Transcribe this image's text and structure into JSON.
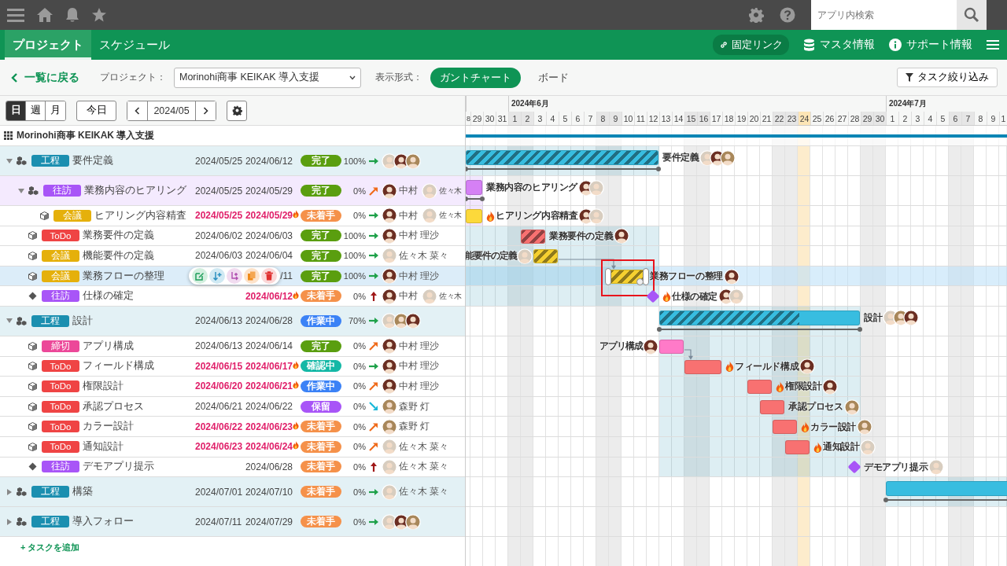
{
  "topbar": {
    "search": {
      "placeholder": "アプリ内検索"
    }
  },
  "nav": {
    "tabs": [
      {
        "label": "プロジェクト",
        "selected": true
      },
      {
        "label": "スケジュール",
        "selected": false
      }
    ],
    "links": [
      {
        "kind": "link",
        "label": "固定リンク"
      },
      {
        "kind": "database",
        "label": "マスタ情報"
      },
      {
        "kind": "info",
        "label": "サポート情報"
      }
    ]
  },
  "toolbar": {
    "back": "一覧に戻る",
    "project_label": "プロジェクト：",
    "project": "Morinohi商事 KEIKAK 導入支援",
    "view_label": "表示形式：",
    "views": [
      {
        "label": "ガントチャート",
        "selected": true
      },
      {
        "label": "ボード",
        "selected": false
      }
    ],
    "filter": "タスク絞り込み"
  },
  "controls": {
    "scales": [
      {
        "label": "日",
        "selected": true
      },
      {
        "label": "週",
        "selected": false
      },
      {
        "label": "月",
        "selected": false
      }
    ],
    "today": "今日",
    "period": "2024/05"
  },
  "project_title": "Morinohi商事 KEIKAK 導入支援",
  "timeline": {
    "lead_days": [
      {
        "label": "8",
        "weekend": false,
        "today": false
      },
      {
        "label": "29",
        "weekend": false,
        "today": false
      },
      {
        "label": "30",
        "weekend": false,
        "today": false
      },
      {
        "label": "31",
        "weekend": false,
        "today": false
      }
    ],
    "months": [
      {
        "label": "2024年6月",
        "days": [
          {
            "label": "1",
            "weekend": true,
            "today": false
          },
          {
            "label": "2",
            "weekend": true,
            "today": false
          },
          {
            "label": "3",
            "weekend": false,
            "today": false
          },
          {
            "label": "4",
            "weekend": false,
            "today": false
          },
          {
            "label": "5",
            "weekend": false,
            "today": false
          },
          {
            "label": "6",
            "weekend": false,
            "today": false
          },
          {
            "label": "7",
            "weekend": false,
            "today": false
          },
          {
            "label": "8",
            "weekend": true,
            "today": false
          },
          {
            "label": "9",
            "weekend": true,
            "today": false
          },
          {
            "label": "10",
            "weekend": false,
            "today": false
          },
          {
            "label": "11",
            "weekend": false,
            "today": false
          },
          {
            "label": "12",
            "weekend": false,
            "today": false
          },
          {
            "label": "13",
            "weekend": false,
            "today": false
          },
          {
            "label": "14",
            "weekend": false,
            "today": false
          },
          {
            "label": "15",
            "weekend": true,
            "today": false
          },
          {
            "label": "16",
            "weekend": true,
            "today": false
          },
          {
            "label": "17",
            "weekend": false,
            "today": false
          },
          {
            "label": "18",
            "weekend": false,
            "today": false
          },
          {
            "label": "19",
            "weekend": false,
            "today": false
          },
          {
            "label": "20",
            "weekend": false,
            "today": false
          },
          {
            "label": "21",
            "weekend": false,
            "today": false
          },
          {
            "label": "22",
            "weekend": true,
            "today": false
          },
          {
            "label": "23",
            "weekend": true,
            "today": false
          },
          {
            "label": "24",
            "weekend": false,
            "today": true
          },
          {
            "label": "25",
            "weekend": false,
            "today": false
          },
          {
            "label": "26",
            "weekend": false,
            "today": false
          },
          {
            "label": "27",
            "weekend": false,
            "today": false
          },
          {
            "label": "28",
            "weekend": false,
            "today": false
          },
          {
            "label": "29",
            "weekend": true,
            "today": false
          },
          {
            "label": "30",
            "weekend": true,
            "today": false
          }
        ]
      },
      {
        "label": "2024年7月",
        "days": [
          {
            "label": "1",
            "weekend": false,
            "today": false
          },
          {
            "label": "2",
            "weekend": false,
            "today": false
          },
          {
            "label": "3",
            "weekend": false,
            "today": false
          },
          {
            "label": "4",
            "weekend": false,
            "today": false
          },
          {
            "label": "5",
            "weekend": false,
            "today": false
          },
          {
            "label": "6",
            "weekend": true,
            "today": false
          },
          {
            "label": "7",
            "weekend": true,
            "today": false
          },
          {
            "label": "8",
            "weekend": false,
            "today": false
          },
          {
            "label": "9",
            "weekend": false,
            "today": false
          },
          {
            "label": "1",
            "weekend": false,
            "today": false
          }
        ]
      }
    ]
  },
  "tasks": [
    {
      "kind": "group",
      "expanded": true,
      "selected": false,
      "tag": {
        "label": "工程",
        "color": "#1b8fb0"
      },
      "name": "要件定義",
      "start": "2024/05/25",
      "end": "2024/06/12",
      "overdue": false,
      "status": {
        "label": "完了",
        "color": "#5a9e0f"
      },
      "progress": "100%",
      "level": 1,
      "priority": {
        "kind": "normal"
      },
      "assignees": [
        {
          "color": "#d8cdbf"
        },
        {
          "color": "#6b2e22"
        },
        {
          "color": "#a8875a"
        }
      ],
      "bar": {
        "kind": "summary",
        "color": "#38bde0",
        "label": {
          "kind": "after",
          "text": "要件定義"
        },
        "link": false
      },
      "children": [
        {
          "kind": "group",
          "expanded": true,
          "selected": false,
          "tag": {
            "label": "往訪",
            "color": "#a855f7"
          },
          "name": "業務内容のヒアリング",
          "start": "2024/05/25",
          "end": "2024/05/29",
          "overdue": false,
          "status": {
            "label": "完了",
            "color": "#5a9e0f"
          },
          "progress": "0%",
          "priority": {
            "kind": "high"
          },
          "assignees": [
            {
              "name": "中村",
              "color": "#6b2e22"
            },
            {
              "name": "佐々木",
              "color": "#d8cdbf"
            }
          ],
          "bar": {
            "kind": "summary",
            "color": "#d580f5",
            "label": {
              "kind": "after",
              "text": "業務内容のヒアリング"
            },
            "link": false
          },
          "children": [
            {
              "kind": "task",
              "selected": false,
              "tag": {
                "label": "会議",
                "color": "#e5b00b"
              },
              "name": "ヒアリング内容精査",
              "start": "2024/05/25",
              "end": "2024/05/29",
              "overdue": true,
              "status": {
                "label": "未着手",
                "color": "#f5914a"
              },
              "progress": "0%",
              "priority": {
                "kind": "normal"
              },
              "assignees": [
                {
                  "name": "中村",
                  "color": "#6b2e22"
                },
                {
                  "name": "佐々木",
                  "color": "#d8cdbf"
                }
              ],
              "bar": {
                "kind": "task",
                "color": "#fcd93b",
                "label": {
                  "kind": "after",
                  "text": "ヒアリング内容精査"
                },
                "link": false
              }
            }
          ]
        },
        {
          "kind": "task",
          "selected": false,
          "tag": {
            "label": "ToDo",
            "color": "#ef4444"
          },
          "name": "業務要件の定義",
          "start": "2024/06/02",
          "end": "2024/06/03",
          "overdue": false,
          "status": {
            "label": "完了",
            "color": "#5a9e0f"
          },
          "progress": "100%",
          "level": 1,
          "priority": {
            "kind": "normal"
          },
          "assignees": [
            {
              "name": "中村 理沙",
              "color": "#6b2e22"
            }
          ],
          "bar": {
            "kind": "task",
            "color": "#f87171",
            "label": {
              "kind": "after",
              "text": "業務要件の定義"
            },
            "link": false
          }
        },
        {
          "kind": "task",
          "selected": false,
          "tag": {
            "label": "会議",
            "color": "#e5b00b"
          },
          "name": "機能要件の定義",
          "start": "2024/06/03",
          "end": "2024/06/04",
          "overdue": false,
          "status": {
            "label": "完了",
            "color": "#5a9e0f"
          },
          "progress": "100%",
          "level": 1,
          "priority": {
            "kind": "normal"
          },
          "assignees": [
            {
              "name": "佐々木 菜々",
              "color": "#d8cdbf"
            }
          ],
          "bar": {
            "kind": "task",
            "color": "#f5d030",
            "label": {
              "kind": "before",
              "text": "能要件の定義"
            },
            "link": true
          }
        },
        {
          "kind": "task",
          "selected": true,
          "tag": {
            "label": "会議",
            "color": "#e5b00b"
          },
          "name": "業務フローの整理",
          "end": "/11",
          "overdue": false,
          "status": {
            "label": "完了",
            "color": "#5a9e0f"
          },
          "progress": "100%",
          "level": 1,
          "priority": {
            "kind": "normal"
          },
          "assignees": [
            {
              "name": "中村 理沙",
              "color": "#6b2e22"
            }
          ],
          "bar": {
            "kind": "task",
            "color": "#f5d030",
            "label": {
              "kind": "after",
              "text": "業務フローの整理"
            },
            "link": false
          }
        },
        {
          "kind": "milestone",
          "selected": false,
          "tag": {
            "label": "往訪",
            "color": "#a855f7"
          },
          "name": "仕様の確定",
          "end": "2024/06/12",
          "overdue": true,
          "status": {
            "label": "未着手",
            "color": "#f5914a"
          },
          "progress": "0%",
          "priority": {
            "kind": "urgent"
          },
          "assignees": [
            {
              "name": "中村",
              "color": "#6b2e22"
            },
            {
              "name": "佐々木",
              "color": "#d8cdbf"
            }
          ],
          "bar": {
            "kind": "milestone",
            "color": "#a855f7",
            "label": {
              "kind": "after",
              "text": "仕様の確定"
            },
            "link": false
          }
        }
      ]
    },
    {
      "kind": "group",
      "expanded": true,
      "selected": false,
      "tag": {
        "label": "工程",
        "color": "#1b8fb0"
      },
      "name": "設計",
      "start": "2024/06/13",
      "end": "2024/06/28",
      "overdue": false,
      "status": {
        "label": "作業中",
        "color": "#3b82f6"
      },
      "progress": "70%",
      "level": 0.7,
      "priority": {
        "kind": "normal"
      },
      "assignees": [
        {
          "color": "#d8cdbf"
        },
        {
          "color": "#a8875a"
        },
        {
          "color": "#6b2e22"
        }
      ],
      "bar": {
        "kind": "summary",
        "color": "#38bde0",
        "label": {
          "kind": "after",
          "text": "設計"
        },
        "link": false
      },
      "children": [
        {
          "kind": "task",
          "selected": false,
          "tag": {
            "label": "締切",
            "color": "#ec4899"
          },
          "name": "アプリ構成",
          "start": "2024/06/13",
          "end": "2024/06/14",
          "overdue": false,
          "status": {
            "label": "完了",
            "color": "#5a9e0f"
          },
          "progress": "0%",
          "priority": {
            "kind": "high"
          },
          "assignees": [
            {
              "name": "中村 理沙",
              "color": "#6b2e22"
            }
          ],
          "bar": {
            "kind": "task",
            "color": "#ff7ac8",
            "label": {
              "kind": "before",
              "text": "アプリ構成"
            },
            "link": true
          }
        },
        {
          "kind": "task",
          "selected": false,
          "tag": {
            "label": "ToDo",
            "color": "#ef4444"
          },
          "name": "フィールド構成",
          "start": "2024/06/15",
          "end": "2024/06/17",
          "overdue": true,
          "status": {
            "label": "確認中",
            "color": "#14b8a6"
          },
          "progress": "0%",
          "priority": {
            "kind": "normal"
          },
          "assignees": [
            {
              "name": "中村 理沙",
              "color": "#6b2e22"
            }
          ],
          "bar": {
            "kind": "task",
            "color": "#f87171",
            "label": {
              "kind": "after",
              "text": "フィールド構成"
            },
            "link": false
          }
        },
        {
          "kind": "task",
          "selected": false,
          "tag": {
            "label": "ToDo",
            "color": "#ef4444"
          },
          "name": "権限設計",
          "start": "2024/06/20",
          "end": "2024/06/21",
          "overdue": true,
          "status": {
            "label": "作業中",
            "color": "#3b82f6"
          },
          "progress": "0%",
          "priority": {
            "kind": "high"
          },
          "assignees": [
            {
              "name": "中村 理沙",
              "color": "#6b2e22"
            }
          ],
          "bar": {
            "kind": "task",
            "color": "#f87171",
            "label": {
              "kind": "after",
              "text": "権限設計"
            },
            "link": false
          }
        },
        {
          "kind": "task",
          "selected": false,
          "tag": {
            "label": "ToDo",
            "color": "#ef4444"
          },
          "name": "承認プロセス",
          "start": "2024/06/21",
          "end": "2024/06/22",
          "overdue": false,
          "status": {
            "label": "保留",
            "color": "#a855f7"
          },
          "progress": "0%",
          "priority": {
            "kind": "low"
          },
          "assignees": [
            {
              "name": "森野 灯",
              "color": "#a8875a"
            }
          ],
          "bar": {
            "kind": "task",
            "color": "#f87171",
            "label": {
              "kind": "after",
              "text": "承認プロセス"
            },
            "link": false
          }
        },
        {
          "kind": "task",
          "selected": false,
          "tag": {
            "label": "ToDo",
            "color": "#ef4444"
          },
          "name": "カラー設計",
          "start": "2024/06/22",
          "end": "2024/06/23",
          "overdue": true,
          "status": {
            "label": "未着手",
            "color": "#f5914a"
          },
          "progress": "0%",
          "priority": {
            "kind": "high"
          },
          "assignees": [
            {
              "name": "森野 灯",
              "color": "#a8875a"
            }
          ],
          "bar": {
            "kind": "task",
            "color": "#f87171",
            "label": {
              "kind": "after",
              "text": "カラー設計"
            },
            "link": false
          }
        },
        {
          "kind": "task",
          "selected": false,
          "tag": {
            "label": "ToDo",
            "color": "#ef4444"
          },
          "name": "通知設計",
          "start": "2024/06/23",
          "end": "2024/06/24",
          "overdue": true,
          "status": {
            "label": "未着手",
            "color": "#f5914a"
          },
          "progress": "0%",
          "priority": {
            "kind": "high"
          },
          "assignees": [
            {
              "name": "佐々木 菜々",
              "color": "#d8cdbf"
            }
          ],
          "bar": {
            "kind": "task",
            "color": "#f87171",
            "label": {
              "kind": "after",
              "text": "通知設計"
            },
            "link": false
          }
        },
        {
          "kind": "milestone",
          "selected": false,
          "tag": {
            "label": "往訪",
            "color": "#a855f7"
          },
          "name": "デモアプリ提示",
          "end": "2024/06/28",
          "overdue": false,
          "status": {
            "label": "未着手",
            "color": "#f5914a"
          },
          "progress": "0%",
          "priority": {
            "kind": "urgent"
          },
          "assignees": [
            {
              "name": "佐々木 菜々",
              "color": "#d8cdbf"
            }
          ],
          "bar": {
            "kind": "milestone",
            "color": "#a855f7",
            "label": {
              "kind": "after",
              "text": "デモアプリ提示"
            },
            "link": false
          }
        }
      ]
    },
    {
      "kind": "group",
      "expanded": false,
      "selected": false,
      "tag": {
        "label": "工程",
        "color": "#1b8fb0"
      },
      "name": "構築",
      "start": "2024/07/01",
      "end": "2024/07/10",
      "overdue": false,
      "status": {
        "label": "未着手",
        "color": "#f5914a"
      },
      "progress": "0%",
      "priority": {
        "kind": "normal"
      },
      "assignees": [
        {
          "name": "佐々木 菜々",
          "color": "#d8cdbf"
        }
      ],
      "bar": {
        "kind": "summary",
        "color": "#38bde0",
        "link": false
      }
    },
    {
      "kind": "group",
      "expanded": false,
      "selected": false,
      "tag": {
        "label": "工程",
        "color": "#1b8fb0"
      },
      "name": "導入フォロー",
      "start": "2024/07/11",
      "end": "2024/07/29",
      "overdue": false,
      "status": {
        "label": "未着手",
        "color": "#f5914a"
      },
      "progress": "0%",
      "priority": {
        "kind": "normal"
      },
      "assignees": [
        {
          "color": "#d8cdbf"
        },
        {
          "color": "#6b2e22"
        },
        {
          "color": "#a8875a"
        }
      ]
    }
  ],
  "add_task": "+ タスクを追加"
}
